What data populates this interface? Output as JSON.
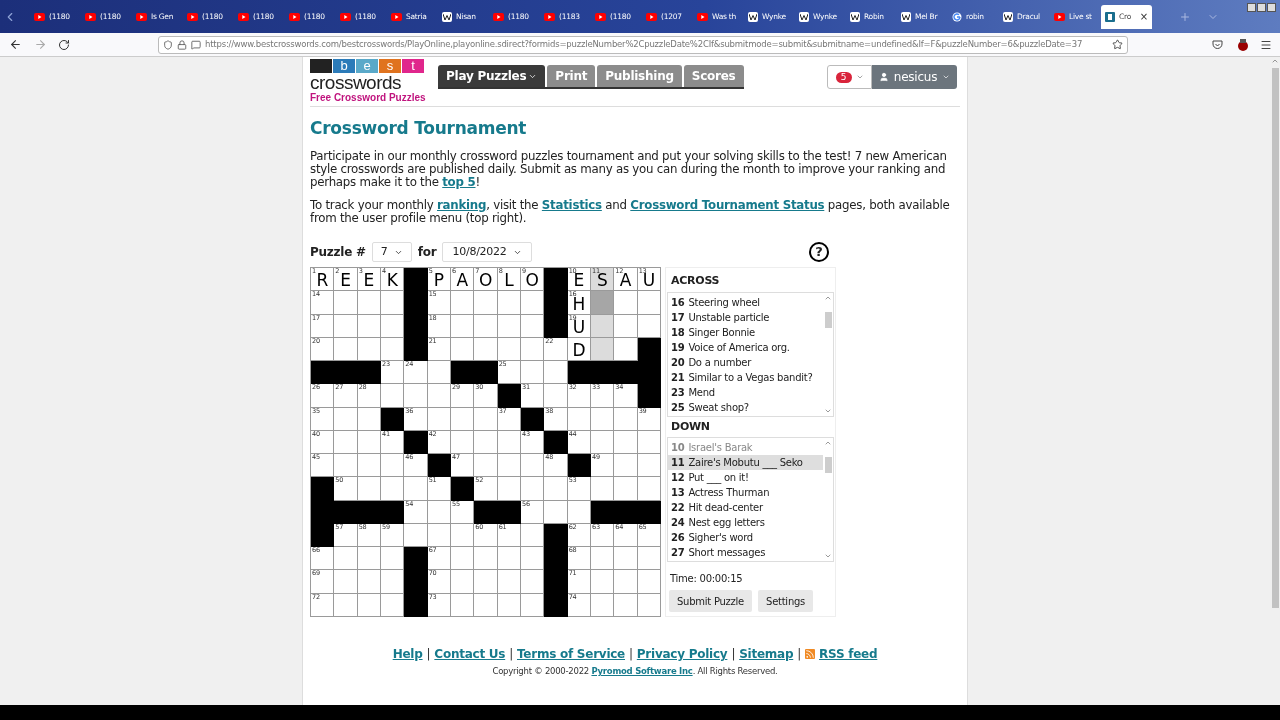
{
  "browser": {
    "tabs": [
      {
        "title": "(1180",
        "kind": "youtube",
        "selected": false
      },
      {
        "title": "(1180",
        "kind": "youtube",
        "selected": false
      },
      {
        "title": "Is Gen",
        "kind": "youtube",
        "selected": false
      },
      {
        "title": "(1180",
        "kind": "youtube",
        "selected": false
      },
      {
        "title": "(1180",
        "kind": "youtube",
        "selected": false
      },
      {
        "title": "(1180",
        "kind": "youtube",
        "selected": false
      },
      {
        "title": "(1180",
        "kind": "youtube",
        "selected": false
      },
      {
        "title": "Satria",
        "kind": "youtube",
        "selected": false
      },
      {
        "title": "Nisan",
        "kind": "wiki",
        "selected": false
      },
      {
        "title": "(1180",
        "kind": "youtube",
        "selected": false
      },
      {
        "title": "(1183",
        "kind": "youtube",
        "selected": false
      },
      {
        "title": "(1180",
        "kind": "youtube",
        "selected": false
      },
      {
        "title": "(1207",
        "kind": "youtube",
        "selected": false
      },
      {
        "title": "Was th",
        "kind": "youtube",
        "selected": false
      },
      {
        "title": "Wynke",
        "kind": "wiki",
        "selected": false
      },
      {
        "title": "Wynke",
        "kind": "wiki",
        "selected": false
      },
      {
        "title": "Robin",
        "kind": "wiki",
        "selected": false
      },
      {
        "title": "Mel Br",
        "kind": "wiki",
        "selected": false
      },
      {
        "title": "robin",
        "kind": "google",
        "selected": false
      },
      {
        "title": "Dracul",
        "kind": "wiki",
        "selected": false
      },
      {
        "title": "Live st",
        "kind": "youtube",
        "selected": false
      },
      {
        "title": "Cro",
        "kind": "site",
        "selected": true,
        "close": "×"
      }
    ],
    "url": "https://www.bestcrosswords.com/bestcrosswords/PlayOnline,playonline.sdirect?formids=puzzleNumber%2CpuzzleDate%2CIf&submitmode=submit&submitname=undefined&If=F&puzzleNumber=6&puzzleDate=37"
  },
  "site": {
    "logo": {
      "tiles": [
        {
          "color": "#222222"
        },
        {
          "letter": "b",
          "color": "#2b7bb9"
        },
        {
          "letter": "e",
          "color": "#5aa9c9"
        },
        {
          "letter": "s",
          "color": "#e0731f"
        },
        {
          "letter": "t",
          "color": "#e0268c"
        }
      ],
      "wordmark": "crosswords",
      "tagline": "Free Crossword Puzzles"
    },
    "nav": [
      {
        "label": "Play Puzzles",
        "selected": true,
        "dropdown": true
      },
      {
        "label": "Print",
        "selected": false,
        "dropdown": false
      },
      {
        "label": "Publishing",
        "selected": false,
        "dropdown": false
      },
      {
        "label": "Scores",
        "selected": false,
        "dropdown": false
      }
    ],
    "notifications": "5",
    "user": "nesicus"
  },
  "page": {
    "title": "Crossword Tournament",
    "paragraphs": [
      [
        {
          "kind": "text",
          "text": "Participate in our monthly crossword puzzles tournament and put your solving skills to the test! 7 new American style crosswords are published daily. Submit as many as you can during the month to improve your ranking and perhaps make it to the "
        },
        {
          "kind": "link",
          "text": "top 5"
        },
        {
          "kind": "text",
          "text": "!"
        }
      ],
      [
        {
          "kind": "text",
          "text": "To track your monthly "
        },
        {
          "kind": "link",
          "text": "ranking"
        },
        {
          "kind": "text",
          "text": ", visit the "
        },
        {
          "kind": "link",
          "text": "Statistics"
        },
        {
          "kind": "text",
          "text": " and "
        },
        {
          "kind": "link",
          "text": "Crossword Tournament Status"
        },
        {
          "kind": "text",
          "text": " pages, both available from the user profile menu (top right)."
        }
      ]
    ],
    "puzzle_label": "Puzzle #",
    "puzzle_number": "7",
    "for_label": "for",
    "date": "10/8/2022",
    "help": "?"
  },
  "grid": [
    [
      {
        "kind": "cell",
        "number": "1",
        "letter": "R"
      },
      {
        "kind": "cell",
        "number": "2",
        "letter": "E"
      },
      {
        "kind": "cell",
        "number": "3",
        "letter": "E"
      },
      {
        "kind": "cell",
        "number": "4",
        "letter": "K"
      },
      {
        "kind": "block"
      },
      {
        "kind": "cell",
        "number": "5",
        "letter": "P"
      },
      {
        "kind": "cell",
        "number": "6",
        "letter": "A"
      },
      {
        "kind": "cell",
        "number": "7",
        "letter": "O"
      },
      {
        "kind": "cell",
        "number": "8",
        "letter": "L"
      },
      {
        "kind": "cell",
        "number": "9",
        "letter": "O"
      },
      {
        "kind": "block"
      },
      {
        "kind": "cell",
        "number": "10",
        "letter": "E"
      },
      {
        "kind": "cell",
        "number": "11",
        "letter": "S",
        "in_word": true
      },
      {
        "kind": "cell",
        "number": "12",
        "letter": "A"
      },
      {
        "kind": "cell",
        "number": "13",
        "letter": "U"
      }
    ],
    [
      {
        "kind": "cell",
        "number": "14"
      },
      {
        "kind": "cell"
      },
      {
        "kind": "cell"
      },
      {
        "kind": "cell"
      },
      {
        "kind": "block"
      },
      {
        "kind": "cell",
        "number": "15"
      },
      {
        "kind": "cell"
      },
      {
        "kind": "cell"
      },
      {
        "kind": "cell"
      },
      {
        "kind": "cell"
      },
      {
        "kind": "block"
      },
      {
        "kind": "cell",
        "number": "16",
        "letter": "H"
      },
      {
        "kind": "cell",
        "active": true
      },
      {
        "kind": "cell"
      },
      {
        "kind": "cell"
      }
    ],
    [
      {
        "kind": "cell",
        "number": "17"
      },
      {
        "kind": "cell"
      },
      {
        "kind": "cell"
      },
      {
        "kind": "cell"
      },
      {
        "kind": "block"
      },
      {
        "kind": "cell",
        "number": "18"
      },
      {
        "kind": "cell"
      },
      {
        "kind": "cell"
      },
      {
        "kind": "cell"
      },
      {
        "kind": "cell"
      },
      {
        "kind": "block"
      },
      {
        "kind": "cell",
        "number": "19",
        "letter": "U"
      },
      {
        "kind": "cell",
        "in_word": true
      },
      {
        "kind": "cell"
      },
      {
        "kind": "cell"
      }
    ],
    [
      {
        "kind": "cell",
        "number": "20"
      },
      {
        "kind": "cell"
      },
      {
        "kind": "cell"
      },
      {
        "kind": "cell"
      },
      {
        "kind": "block"
      },
      {
        "kind": "cell",
        "number": "21"
      },
      {
        "kind": "cell"
      },
      {
        "kind": "cell"
      },
      {
        "kind": "cell"
      },
      {
        "kind": "cell"
      },
      {
        "kind": "cell",
        "number": "22"
      },
      {
        "kind": "cell",
        "letter": "D"
      },
      {
        "kind": "cell",
        "in_word": true
      },
      {
        "kind": "cell"
      },
      {
        "kind": "block"
      }
    ],
    [
      {
        "kind": "block"
      },
      {
        "kind": "block"
      },
      {
        "kind": "block"
      },
      {
        "kind": "cell",
        "number": "23"
      },
      {
        "kind": "cell",
        "number": "24"
      },
      {
        "kind": "cell"
      },
      {
        "kind": "block"
      },
      {
        "kind": "block"
      },
      {
        "kind": "cell",
        "number": "25"
      },
      {
        "kind": "cell"
      },
      {
        "kind": "cell"
      },
      {
        "kind": "block"
      },
      {
        "kind": "block"
      },
      {
        "kind": "block"
      },
      {
        "kind": "block"
      }
    ],
    [
      {
        "kind": "cell",
        "number": "26"
      },
      {
        "kind": "cell",
        "number": "27"
      },
      {
        "kind": "cell",
        "number": "28"
      },
      {
        "kind": "cell"
      },
      {
        "kind": "cell"
      },
      {
        "kind": "cell"
      },
      {
        "kind": "cell",
        "number": "29"
      },
      {
        "kind": "cell",
        "number": "30"
      },
      {
        "kind": "block"
      },
      {
        "kind": "cell",
        "number": "31"
      },
      {
        "kind": "cell"
      },
      {
        "kind": "cell",
        "number": "32"
      },
      {
        "kind": "cell",
        "number": "33"
      },
      {
        "kind": "cell",
        "number": "34"
      },
      {
        "kind": "block"
      }
    ],
    [
      {
        "kind": "cell",
        "number": "35"
      },
      {
        "kind": "cell"
      },
      {
        "kind": "cell"
      },
      {
        "kind": "block"
      },
      {
        "kind": "cell",
        "number": "36"
      },
      {
        "kind": "cell"
      },
      {
        "kind": "cell"
      },
      {
        "kind": "cell"
      },
      {
        "kind": "cell",
        "number": "37"
      },
      {
        "kind": "block"
      },
      {
        "kind": "cell",
        "number": "38"
      },
      {
        "kind": "cell"
      },
      {
        "kind": "cell"
      },
      {
        "kind": "cell"
      },
      {
        "kind": "cell",
        "number": "39"
      }
    ],
    [
      {
        "kind": "cell",
        "number": "40"
      },
      {
        "kind": "cell"
      },
      {
        "kind": "cell"
      },
      {
        "kind": "cell",
        "number": "41"
      },
      {
        "kind": "block"
      },
      {
        "kind": "cell",
        "number": "42"
      },
      {
        "kind": "cell"
      },
      {
        "kind": "cell"
      },
      {
        "kind": "cell"
      },
      {
        "kind": "cell",
        "number": "43"
      },
      {
        "kind": "block"
      },
      {
        "kind": "cell",
        "number": "44"
      },
      {
        "kind": "cell"
      },
      {
        "kind": "cell"
      },
      {
        "kind": "cell"
      }
    ],
    [
      {
        "kind": "cell",
        "number": "45"
      },
      {
        "kind": "cell"
      },
      {
        "kind": "cell"
      },
      {
        "kind": "cell"
      },
      {
        "kind": "cell",
        "number": "46"
      },
      {
        "kind": "block"
      },
      {
        "kind": "cell",
        "number": "47"
      },
      {
        "kind": "cell"
      },
      {
        "kind": "cell"
      },
      {
        "kind": "cell"
      },
      {
        "kind": "cell",
        "number": "48"
      },
      {
        "kind": "block"
      },
      {
        "kind": "cell",
        "number": "49"
      },
      {
        "kind": "cell"
      },
      {
        "kind": "cell"
      }
    ],
    [
      {
        "kind": "block"
      },
      {
        "kind": "cell",
        "number": "50"
      },
      {
        "kind": "cell"
      },
      {
        "kind": "cell"
      },
      {
        "kind": "cell"
      },
      {
        "kind": "cell",
        "number": "51"
      },
      {
        "kind": "block"
      },
      {
        "kind": "cell",
        "number": "52"
      },
      {
        "kind": "cell"
      },
      {
        "kind": "cell"
      },
      {
        "kind": "cell"
      },
      {
        "kind": "cell",
        "number": "53"
      },
      {
        "kind": "cell"
      },
      {
        "kind": "cell"
      },
      {
        "kind": "cell"
      }
    ],
    [
      {
        "kind": "block"
      },
      {
        "kind": "block"
      },
      {
        "kind": "block"
      },
      {
        "kind": "block"
      },
      {
        "kind": "cell",
        "number": "54"
      },
      {
        "kind": "cell"
      },
      {
        "kind": "cell",
        "number": "55"
      },
      {
        "kind": "block"
      },
      {
        "kind": "block"
      },
      {
        "kind": "cell",
        "number": "56"
      },
      {
        "kind": "cell"
      },
      {
        "kind": "cell"
      },
      {
        "kind": "block"
      },
      {
        "kind": "block"
      },
      {
        "kind": "block"
      }
    ],
    [
      {
        "kind": "block"
      },
      {
        "kind": "cell",
        "number": "57"
      },
      {
        "kind": "cell",
        "number": "58"
      },
      {
        "kind": "cell",
        "number": "59"
      },
      {
        "kind": "cell"
      },
      {
        "kind": "cell"
      },
      {
        "kind": "cell"
      },
      {
        "kind": "cell",
        "number": "60"
      },
      {
        "kind": "cell",
        "number": "61"
      },
      {
        "kind": "cell"
      },
      {
        "kind": "block"
      },
      {
        "kind": "cell",
        "number": "62"
      },
      {
        "kind": "cell",
        "number": "63"
      },
      {
        "kind": "cell",
        "number": "64"
      },
      {
        "kind": "cell",
        "number": "65"
      }
    ],
    [
      {
        "kind": "cell",
        "number": "66"
      },
      {
        "kind": "cell"
      },
      {
        "kind": "cell"
      },
      {
        "kind": "cell"
      },
      {
        "kind": "block"
      },
      {
        "kind": "cell",
        "number": "67"
      },
      {
        "kind": "cell"
      },
      {
        "kind": "cell"
      },
      {
        "kind": "cell"
      },
      {
        "kind": "cell"
      },
      {
        "kind": "block"
      },
      {
        "kind": "cell",
        "number": "68"
      },
      {
        "kind": "cell"
      },
      {
        "kind": "cell"
      },
      {
        "kind": "cell"
      }
    ],
    [
      {
        "kind": "cell",
        "number": "69"
      },
      {
        "kind": "cell"
      },
      {
        "kind": "cell"
      },
      {
        "kind": "cell"
      },
      {
        "kind": "block"
      },
      {
        "kind": "cell",
        "number": "70"
      },
      {
        "kind": "cell"
      },
      {
        "kind": "cell"
      },
      {
        "kind": "cell"
      },
      {
        "kind": "cell"
      },
      {
        "kind": "block"
      },
      {
        "kind": "cell",
        "number": "71"
      },
      {
        "kind": "cell"
      },
      {
        "kind": "cell"
      },
      {
        "kind": "cell"
      }
    ],
    [
      {
        "kind": "cell",
        "number": "72"
      },
      {
        "kind": "cell"
      },
      {
        "kind": "cell"
      },
      {
        "kind": "cell"
      },
      {
        "kind": "block"
      },
      {
        "kind": "cell",
        "number": "73"
      },
      {
        "kind": "cell"
      },
      {
        "kind": "cell"
      },
      {
        "kind": "cell"
      },
      {
        "kind": "cell"
      },
      {
        "kind": "block"
      },
      {
        "kind": "cell",
        "number": "74"
      },
      {
        "kind": "cell"
      },
      {
        "kind": "cell"
      },
      {
        "kind": "cell"
      }
    ]
  ],
  "clues": {
    "across_title": "ACROSS",
    "across": [
      {
        "number": "16",
        "text": "Steering wheel",
        "selected": false,
        "solved": false
      },
      {
        "number": "17",
        "text": "Unstable particle",
        "selected": false,
        "solved": false
      },
      {
        "number": "18",
        "text": "Singer Bonnie",
        "selected": false,
        "solved": false
      },
      {
        "number": "19",
        "text": "Voice of America org.",
        "selected": false,
        "solved": false
      },
      {
        "number": "20",
        "text": "Do a number",
        "selected": false,
        "solved": false
      },
      {
        "number": "21",
        "text": "Similar to a Vegas bandit?",
        "selected": false,
        "solved": false
      },
      {
        "number": "23",
        "text": "Mend",
        "selected": false,
        "solved": false
      },
      {
        "number": "25",
        "text": "Sweat shop?",
        "selected": false,
        "solved": false
      }
    ],
    "down_title": "DOWN",
    "down": [
      {
        "number": "10",
        "text": "Israel's Barak",
        "selected": false,
        "solved": true
      },
      {
        "number": "11",
        "text": "Zaire's Mobutu ___ Seko",
        "selected": true,
        "solved": false
      },
      {
        "number": "12",
        "text": "Put ___ on it!",
        "selected": false,
        "solved": false
      },
      {
        "number": "13",
        "text": "Actress Thurman",
        "selected": false,
        "solved": false
      },
      {
        "number": "22",
        "text": "Hit dead-center",
        "selected": false,
        "solved": false
      },
      {
        "number": "24",
        "text": "Nest egg letters",
        "selected": false,
        "solved": false
      },
      {
        "number": "26",
        "text": "Sigher's word",
        "selected": false,
        "solved": false
      },
      {
        "number": "27",
        "text": "Short messages",
        "selected": false,
        "solved": false
      }
    ],
    "timer": "Time: 00:00:15",
    "buttons": [
      "Submit Puzzle",
      "Settings"
    ]
  },
  "footer": {
    "links": [
      "Help",
      "Contact Us",
      "Terms of Service",
      "Privacy Policy",
      "Sitemap",
      "RSS feed"
    ],
    "separator": "|",
    "copyright": [
      {
        "kind": "text",
        "text": "Copyright © 2000-2022 "
      },
      {
        "kind": "link",
        "text": "Pyromod Software Inc"
      },
      {
        "kind": "text",
        "text": ". All Rights Reserved."
      }
    ]
  }
}
